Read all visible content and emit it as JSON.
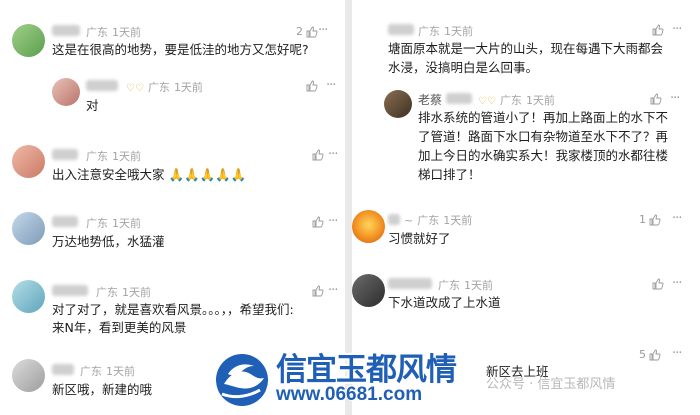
{
  "meta": {
    "region": "广东",
    "time": "1天前",
    "more": "···",
    "badge": "♡♡"
  },
  "left": [
    {
      "likes": "2",
      "text": "这是在很高的地势，要是低洼的地方又怎好呢?",
      "name": "",
      "reply": {
        "text": "对"
      }
    },
    {
      "likes": "",
      "text": "出入注意安全哦大家",
      "emoji": "🙏🙏🙏🙏🙏"
    },
    {
      "likes": "",
      "text": "万达地势低，水猛灌"
    },
    {
      "likes": "",
      "text": "对了对了，就是喜欢看风景。。。，，希望我们:",
      "text2": "来N年，看到更美的风景"
    },
    {
      "likes": "",
      "text": "新区哦，新建的哦"
    }
  ],
  "right": [
    {
      "likes": "",
      "text": "塘面原本就是一大片的山头，现在每遇下大雨都会",
      "text2": "水浸，没搞明白是么回事。",
      "reply": {
        "name": "老蔡",
        "lines": [
          "排水系统的管道小了！再加上路面上的水下不",
          "了管道！路面下水口有杂物道至水下不了？再",
          "加上今日的水确实系大！我家楼顶的水都往楼",
          "梯口排了！"
        ]
      }
    },
    {
      "likes": "1",
      "name": "~",
      "text": "习惯就好了"
    },
    {
      "likes": "",
      "text": "下水道改成了上水道"
    },
    {
      "likes": "5",
      "text": "新区去上班"
    }
  ],
  "watermark": {
    "title": "信宜玉都风情",
    "url": "www.06681.com",
    "official": "公众号 · 信宜玉都风情"
  }
}
